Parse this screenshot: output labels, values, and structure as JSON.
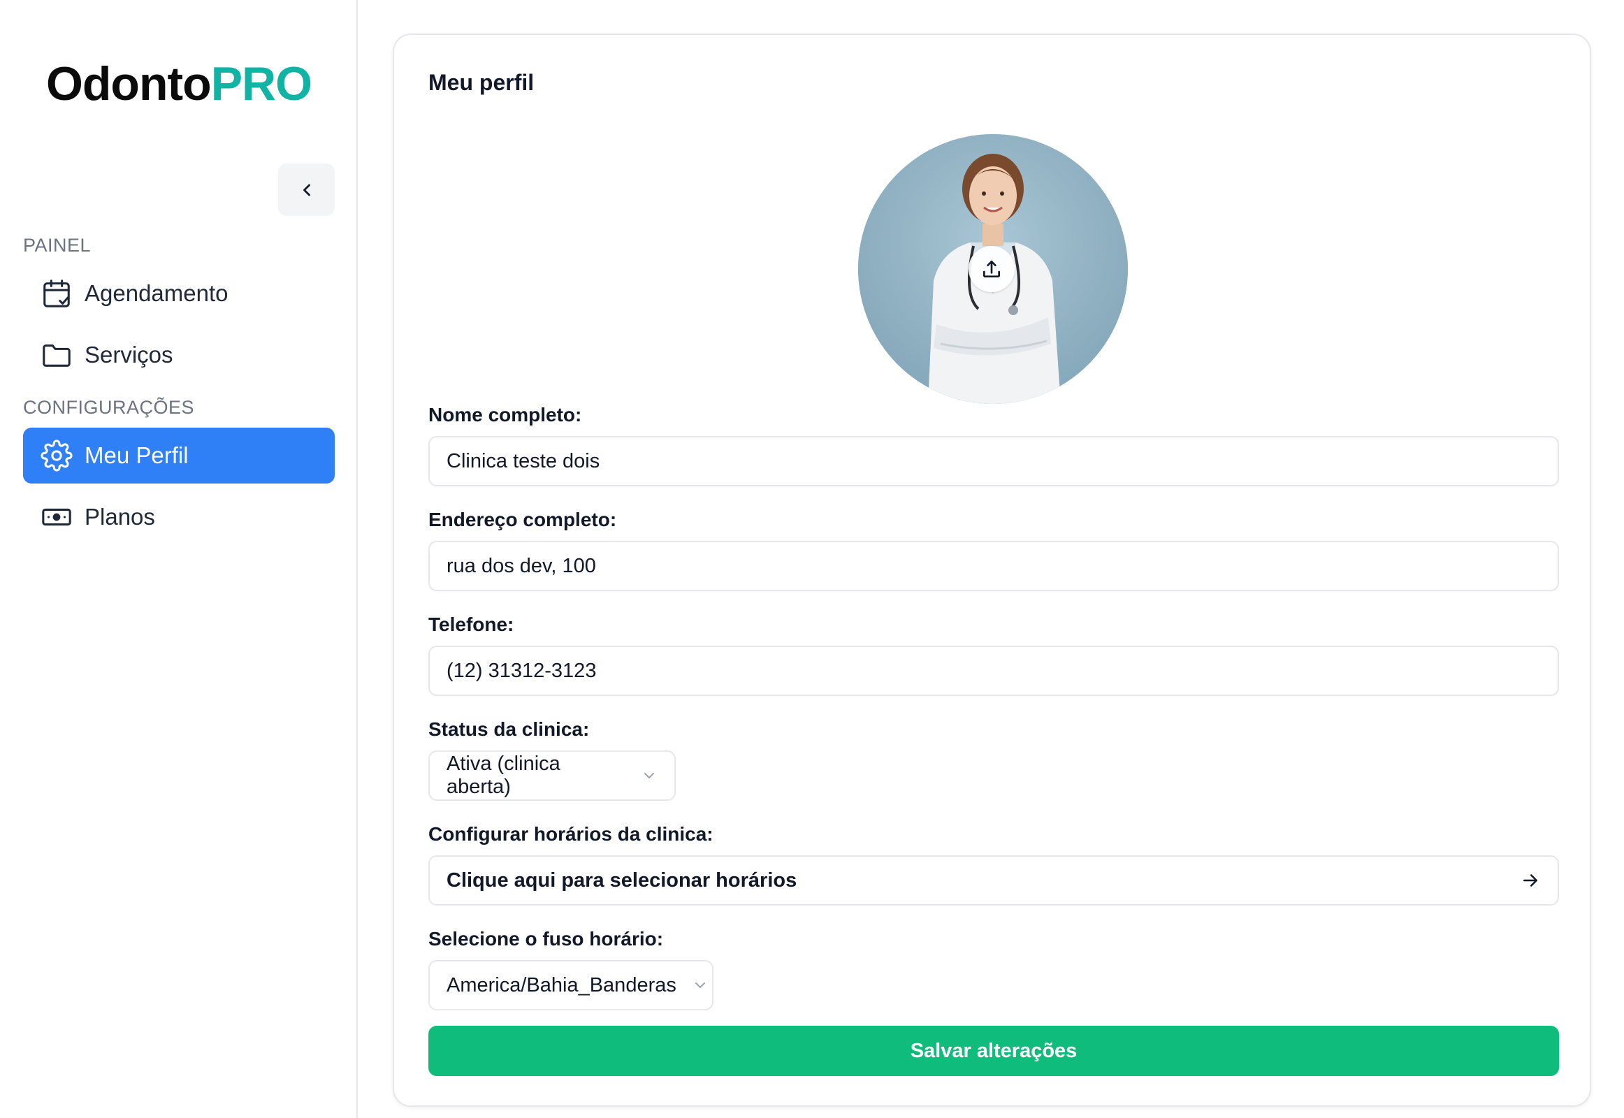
{
  "brand": {
    "name_part1": "Odonto",
    "name_part2": "PRO",
    "accent_color": "#10b3a4"
  },
  "sidebar": {
    "collapse_icon": "chevron-left-icon",
    "sections": [
      {
        "label": "PAINEL"
      },
      {
        "label": "CONFIGURAÇÕES"
      }
    ],
    "items": [
      {
        "label": "Agendamento",
        "icon": "calendar-check-icon",
        "active": false
      },
      {
        "label": "Serviços",
        "icon": "folder-icon",
        "active": false
      },
      {
        "label": "Meu Perfil",
        "icon": "gear-icon",
        "active": true
      },
      {
        "label": "Planos",
        "icon": "banknote-icon",
        "active": false
      }
    ],
    "active_color": "#2f7ff6"
  },
  "profile": {
    "title": "Meu perfil",
    "upload_icon": "upload-icon",
    "fields": {
      "name": {
        "label": "Nome completo:",
        "value": "Clinica teste dois"
      },
      "address": {
        "label": "Endereço completo:",
        "value": "rua dos dev, 100"
      },
      "phone": {
        "label": "Telefone:",
        "value": "(12) 31312-3123"
      },
      "status": {
        "label": "Status da clinica:",
        "value": "Ativa (clinica aberta)"
      },
      "hours": {
        "label": "Configurar horários da clinica:",
        "button": "Clique aqui para selecionar horários"
      },
      "timezone": {
        "label": "Selecione o fuso horário:",
        "value": "America/Bahia_Banderas"
      }
    },
    "save_label": "Salvar alterações",
    "save_color": "#10bc7c"
  }
}
